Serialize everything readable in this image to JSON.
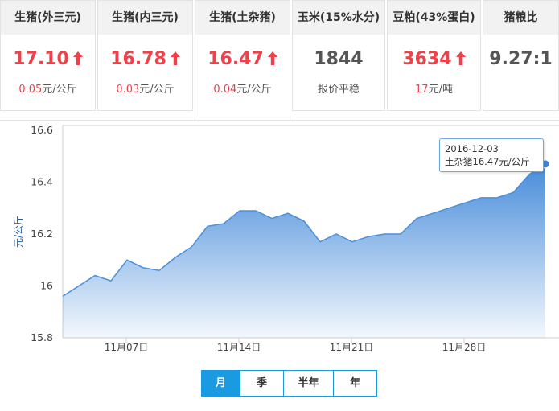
{
  "cards": [
    {
      "title": "生猪(外三元)",
      "value": "17.10",
      "up": true,
      "sub_num": "0.05",
      "sub_unit": "元/公斤"
    },
    {
      "title": "生猪(内三元)",
      "value": "16.78",
      "up": true,
      "sub_num": "0.03",
      "sub_unit": "元/公斤"
    },
    {
      "title": "生猪(土杂猪)",
      "value": "16.47",
      "up": true,
      "sub_num": "0.04",
      "sub_unit": "元/公斤",
      "active": true
    },
    {
      "title": "玉米(15%水分)",
      "value": "1844",
      "up": false,
      "sub_num": "",
      "sub_unit": "报价平稳"
    },
    {
      "title": "豆粕(43%蛋白)",
      "value": "3634",
      "up": true,
      "sub_num": "17",
      "sub_unit": "元/吨"
    },
    {
      "title": "猪粮比",
      "value": "9.27:1",
      "up": false,
      "sub_num": "",
      "sub_unit": ""
    }
  ],
  "colors": {
    "up": "#f0404a",
    "line": "#4a90d9",
    "accent": "#1a9ae0"
  },
  "tooltip": {
    "date": "2016-12-03",
    "text": "土杂猪16.47元/公斤"
  },
  "range_buttons": [
    "月",
    "季",
    "半年",
    "年"
  ],
  "selected_range": "月",
  "chart_data": {
    "type": "area",
    "x": [
      "2016-11-03",
      "2016-11-04",
      "2016-11-05",
      "2016-11-06",
      "2016-11-07",
      "2016-11-08",
      "2016-11-09",
      "2016-11-10",
      "2016-11-11",
      "2016-11-12",
      "2016-11-13",
      "2016-11-14",
      "2016-11-15",
      "2016-11-16",
      "2016-11-17",
      "2016-11-18",
      "2016-11-19",
      "2016-11-20",
      "2016-11-21",
      "2016-11-22",
      "2016-11-23",
      "2016-11-24",
      "2016-11-25",
      "2016-11-26",
      "2016-11-27",
      "2016-11-28",
      "2016-11-29",
      "2016-11-30",
      "2016-12-01",
      "2016-12-02",
      "2016-12-03"
    ],
    "series": [
      {
        "values": [
          15.96,
          16.0,
          16.04,
          16.02,
          16.1,
          16.07,
          16.06,
          16.11,
          16.15,
          16.23,
          16.24,
          16.29,
          16.29,
          16.26,
          16.28,
          16.25,
          16.17,
          16.2,
          16.17,
          16.19,
          16.2,
          16.2,
          16.26,
          16.28,
          16.3,
          16.32,
          16.34,
          16.34,
          16.36,
          16.43,
          16.47
        ]
      }
    ],
    "x_ticks": [
      "11月07日",
      "11月14日",
      "11月21日",
      "11月28日"
    ],
    "y_ticks": [
      "15.8",
      "16",
      "16.2",
      "16.4",
      "16.6"
    ],
    "ylim": [
      15.8,
      16.6
    ],
    "ylabel": "元/公斤",
    "grid": false
  }
}
